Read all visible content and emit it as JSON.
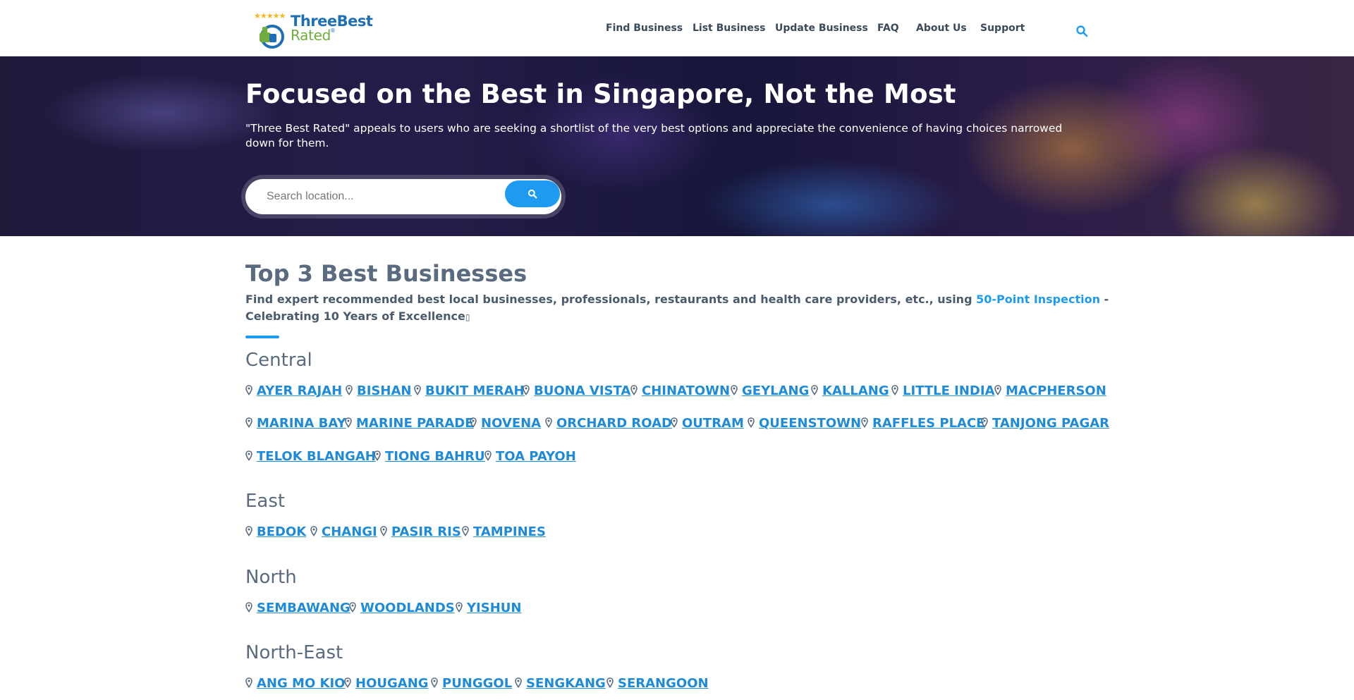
{
  "logo": {
    "line1": "ThreeBest",
    "line2": "Rated",
    "reg": "®",
    "stars": "★★★★★"
  },
  "nav": {
    "items": [
      {
        "label": "Find Business"
      },
      {
        "label": "List Business"
      },
      {
        "label": "Update Business"
      },
      {
        "label": "FAQ"
      },
      {
        "label": "About Us"
      },
      {
        "label": "Support"
      }
    ],
    "search_icon": "search-icon"
  },
  "hero": {
    "title": "Focused on the Best in Singapore, Not the Most",
    "subtitle": "\"Three Best Rated\" appeals to users who are seeking a shortlist of the very best options and appreciate the convenience of having choices narrowed down for them.",
    "search_placeholder": "Search location...",
    "search_button_icon": "search-icon"
  },
  "main": {
    "title": "Top 3 Best Businesses",
    "desc_before": "Find expert recommended best local businesses, professionals, restaurants and health care providers, etc., using ",
    "desc_link": "50-Point Inspection",
    "desc_after": " - Celebrating 10 Years of Excellence",
    "desc_trail_glyph": "▯"
  },
  "regions": [
    {
      "name": "Central",
      "locations": [
        "AYER RAJAH",
        "BISHAN",
        "BUKIT MERAH",
        "BUONA VISTA",
        "CHINATOWN",
        "GEYLANG",
        "KALLANG",
        "LITTLE INDIA",
        "MACPHERSON",
        "MARINA BAY",
        "MARINE PARADE",
        "NOVENA",
        "ORCHARD ROAD",
        "OUTRAM",
        "QUEENSTOWN",
        "RAFFLES PLACE",
        "TANJONG PAGAR",
        "TELOK BLANGAH",
        "TIONG BAHRU",
        "TOA PAYOH"
      ]
    },
    {
      "name": "East",
      "locations": [
        "BEDOK",
        "CHANGI",
        "PASIR RIS",
        "TAMPINES"
      ]
    },
    {
      "name": "North",
      "locations": [
        "SEMBAWANG",
        "WOODLANDS",
        "YISHUN"
      ]
    },
    {
      "name": "North-East",
      "locations": [
        "ANG MO KIO",
        "HOUGANG",
        "PUNGGOL",
        "SENGKANG",
        "SERANGOON"
      ]
    }
  ],
  "colors": {
    "accent": "#1e9bf0",
    "link": "#1e8ad8",
    "heading": "#5a6b80",
    "logo_blue": "#1f6fb5",
    "logo_green": "#6fae3e",
    "star": "#f3b815"
  }
}
